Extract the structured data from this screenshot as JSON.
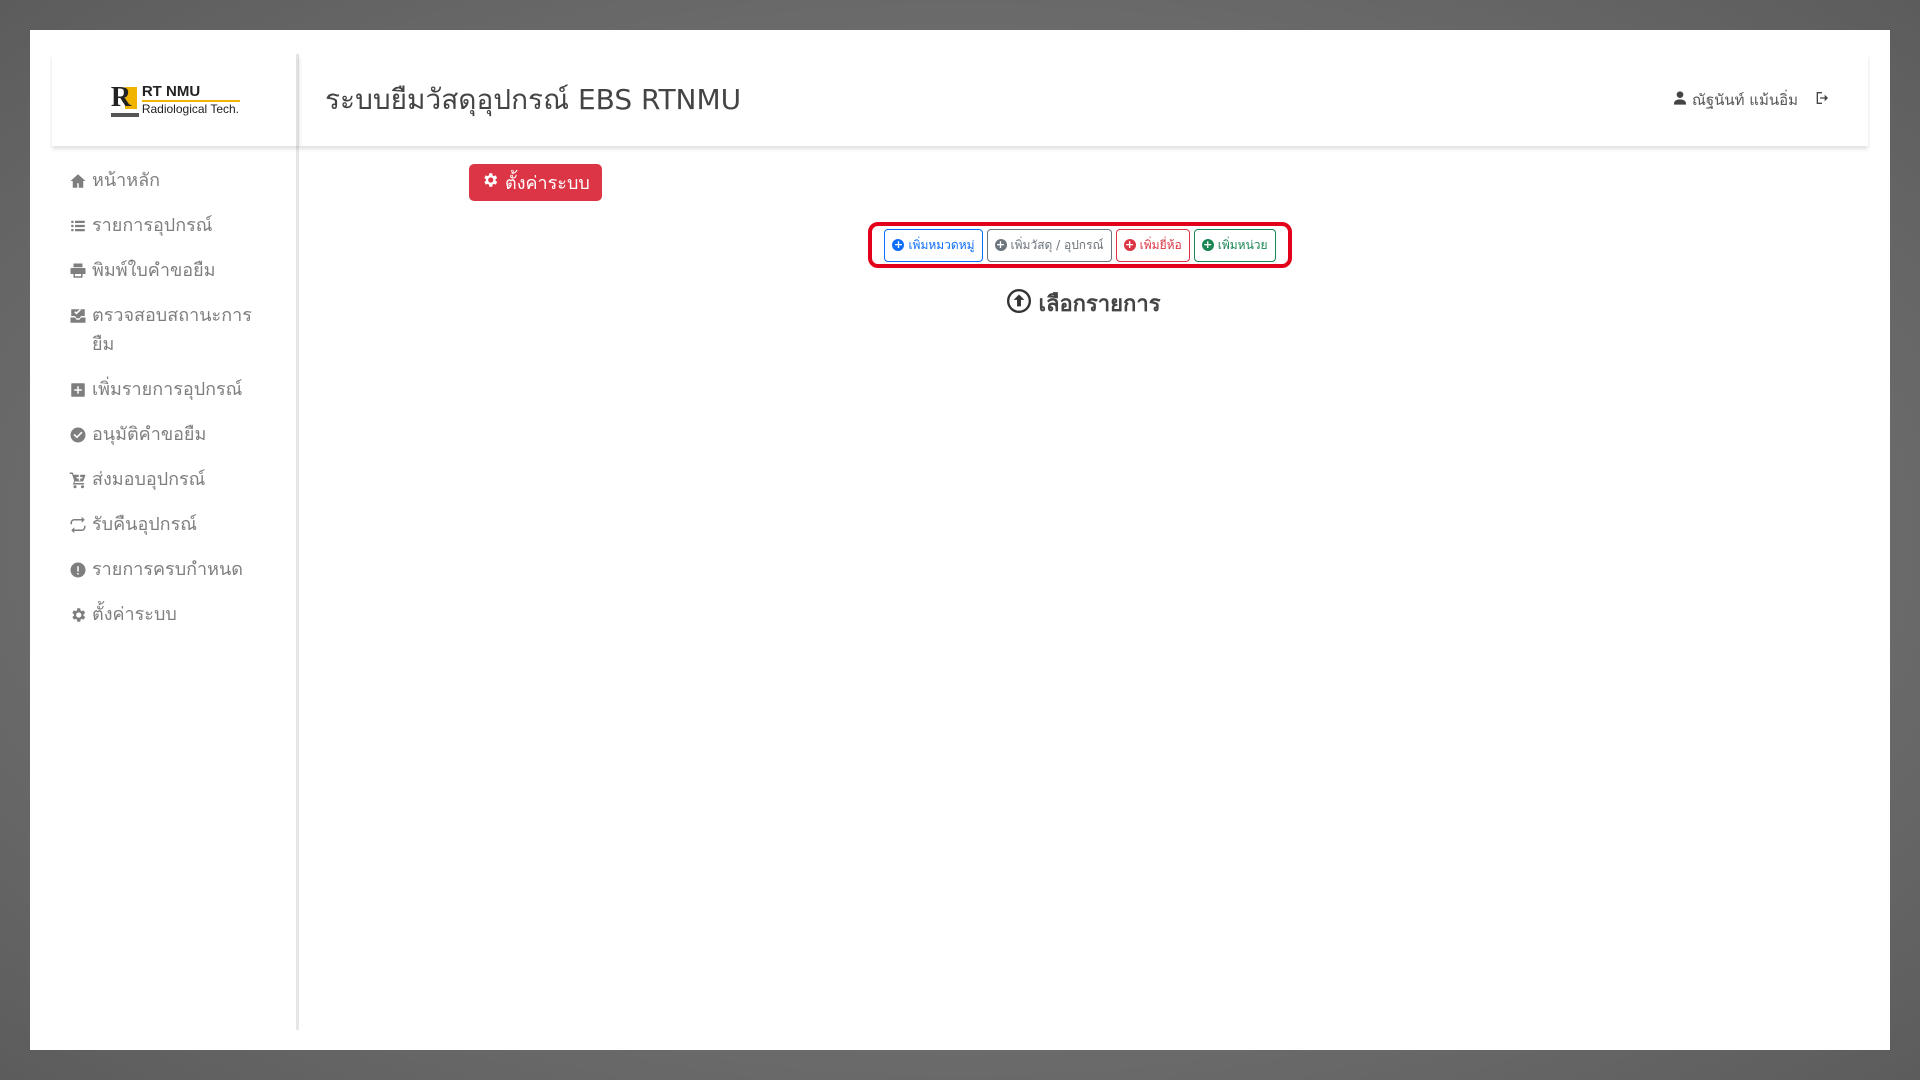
{
  "logo": {
    "line1": "RT NMU",
    "line2": "Radiological Tech.",
    "mark_r": "R"
  },
  "header": {
    "title": "ระบบยืมวัสดุอุปกรณ์ EBS RTNMU",
    "user_name": "ณัฐนันท์ แม้นอิ่ม"
  },
  "sidebar": {
    "items": [
      {
        "label": "หน้าหลัก",
        "icon": "home-icon"
      },
      {
        "label": "รายการอุปกรณ์",
        "icon": "list-icon"
      },
      {
        "label": "พิมพ์ใบคำขอยืม",
        "icon": "printer-icon"
      },
      {
        "label": "ตรวจสอบสถานะการยืม",
        "icon": "inbox-check-icon"
      },
      {
        "label": "เพิ่มรายการอุปกรณ์",
        "icon": "plus-square-icon"
      },
      {
        "label": "อนุมัติคำขอยืม",
        "icon": "check-circle-icon"
      },
      {
        "label": "ส่งมอบอุปกรณ์",
        "icon": "cart-plus-icon"
      },
      {
        "label": "รับคืนอุปกรณ์",
        "icon": "repeat-icon"
      },
      {
        "label": "รายการครบกำหนด",
        "icon": "exclamation-circle-icon"
      },
      {
        "label": "ตั้งค่าระบบ",
        "icon": "gear-icon"
      }
    ]
  },
  "main": {
    "settings_button": "ตั้งค่าระบบ",
    "actions": [
      {
        "label": "เพิ่มหมวดหมู่",
        "style": "blue"
      },
      {
        "label": "เพิ่มวัสดุ / อุปกรณ์",
        "style": "gray"
      },
      {
        "label": "เพิ่มยี่ห้อ",
        "style": "red"
      },
      {
        "label": "เพิ่มหน่วย",
        "style": "green"
      }
    ],
    "prompt": "เลือกรายการ"
  },
  "colors": {
    "danger": "#dc3545",
    "primary": "#0d6efd",
    "secondary": "#6c757d",
    "success": "#198754",
    "highlight": "#e3001b"
  }
}
